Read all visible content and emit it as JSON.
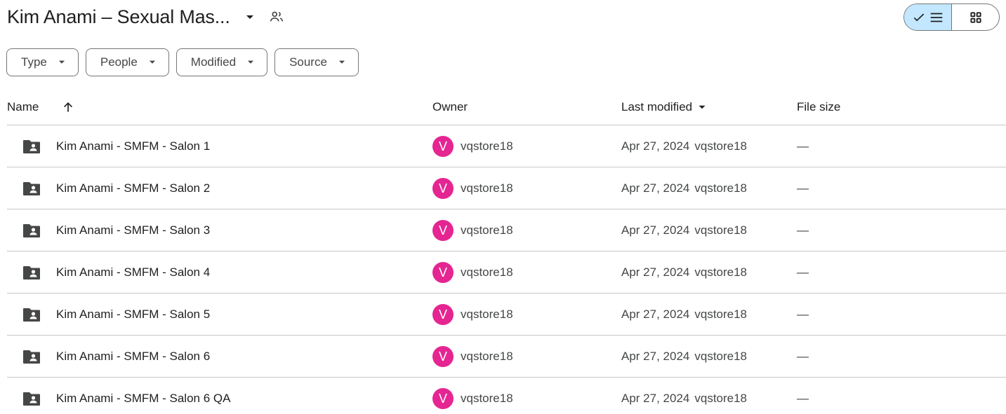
{
  "header": {
    "title": "Kim Anami – Sexual Mas...",
    "caret_icon": "arrow-drop-down-icon",
    "shared_icon": "people-outline-icon"
  },
  "view_toggle": {
    "list_icon": "check-list-icon",
    "grid_icon": "grid-view-icon",
    "active": "list",
    "active_color": "#c2e7ff"
  },
  "filters": [
    {
      "label": "Type"
    },
    {
      "label": "People"
    },
    {
      "label": "Modified"
    },
    {
      "label": "Source"
    }
  ],
  "table": {
    "columns": {
      "name": "Name",
      "owner": "Owner",
      "last_modified": "Last modified",
      "file_size": "File size"
    },
    "sort_icon": "arrow-upward-icon",
    "rows": [
      {
        "name": "Kim Anami - SMFM - Salon 1",
        "owner_initial": "V",
        "owner": "vqstore18",
        "modified_date": "Apr 27, 2024",
        "modified_by": "vqstore18",
        "size": "—"
      },
      {
        "name": "Kim Anami - SMFM - Salon 2",
        "owner_initial": "V",
        "owner": "vqstore18",
        "modified_date": "Apr 27, 2024",
        "modified_by": "vqstore18",
        "size": "—"
      },
      {
        "name": "Kim Anami - SMFM - Salon 3",
        "owner_initial": "V",
        "owner": "vqstore18",
        "modified_date": "Apr 27, 2024",
        "modified_by": "vqstore18",
        "size": "—"
      },
      {
        "name": "Kim Anami - SMFM - Salon 4",
        "owner_initial": "V",
        "owner": "vqstore18",
        "modified_date": "Apr 27, 2024",
        "modified_by": "vqstore18",
        "size": "—"
      },
      {
        "name": "Kim Anami - SMFM - Salon 5",
        "owner_initial": "V",
        "owner": "vqstore18",
        "modified_date": "Apr 27, 2024",
        "modified_by": "vqstore18",
        "size": "—"
      },
      {
        "name": "Kim Anami - SMFM - Salon 6",
        "owner_initial": "V",
        "owner": "vqstore18",
        "modified_date": "Apr 27, 2024",
        "modified_by": "vqstore18",
        "size": "—"
      },
      {
        "name": "Kim Anami - SMFM - Salon 6 QA",
        "owner_initial": "V",
        "owner": "vqstore18",
        "modified_date": "Apr 27, 2024",
        "modified_by": "vqstore18",
        "size": "—"
      }
    ],
    "row_icon": "shared-folder-icon",
    "avatar_color": "#e52592"
  }
}
